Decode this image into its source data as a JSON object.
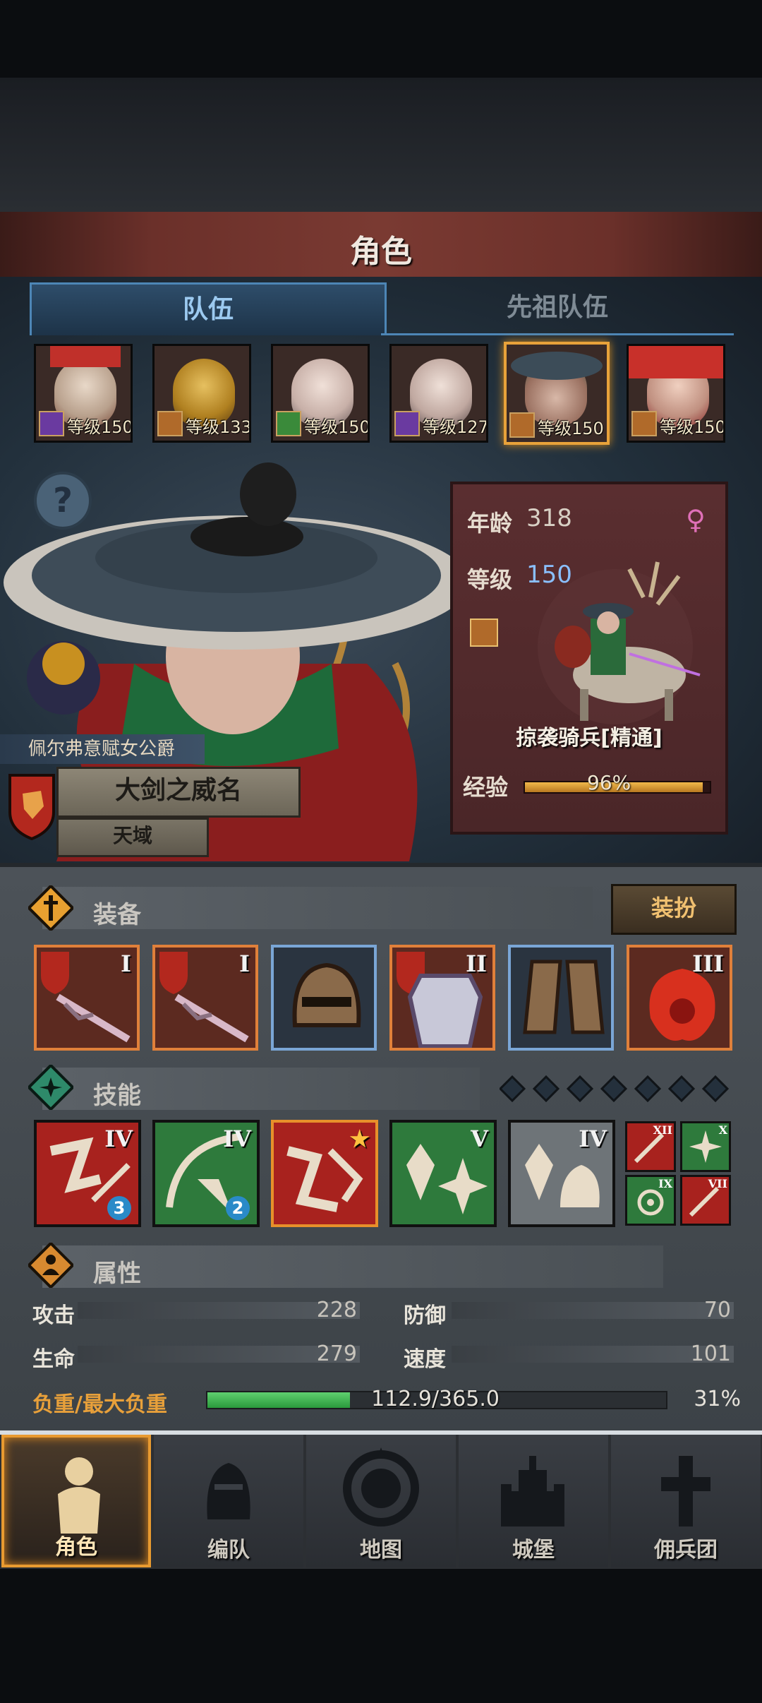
{
  "header": {
    "title": "角色"
  },
  "tabs": [
    {
      "label": "队伍",
      "active": true
    },
    {
      "label": "先祖队伍",
      "active": false
    }
  ],
  "team": [
    {
      "level_text": "等级150",
      "class_icon": "staff-icon",
      "selected": false
    },
    {
      "level_text": "等级133",
      "class_icon": "horse-icon",
      "selected": false
    },
    {
      "level_text": "等级150",
      "class_icon": "bow-icon",
      "selected": false
    },
    {
      "level_text": "等级127",
      "class_icon": "staff-icon",
      "selected": false
    },
    {
      "level_text": "等级150",
      "class_icon": "horse-icon",
      "selected": true
    },
    {
      "level_text": "等级150",
      "class_icon": "horse-icon",
      "selected": false
    }
  ],
  "hero": {
    "owner": "佩尔弗意赋女公爵",
    "name": "大剑之威名",
    "rank": "天域"
  },
  "stats_card": {
    "age_label": "年龄",
    "age": "318",
    "level_label": "等级",
    "level": "150",
    "class_name": "掠袭骑兵[精通]",
    "exp_label": "经验",
    "exp_text": "96%",
    "exp_fraction": 0.96
  },
  "equipment": {
    "title": "装备",
    "outfit_button": "装扮",
    "slots": [
      {
        "item": "rose-blade-icon",
        "tier": "I",
        "frame": "orange"
      },
      {
        "item": "rose-blade-icon",
        "tier": "I",
        "frame": "orange"
      },
      {
        "item": "helmet-icon",
        "tier": "",
        "frame": "blue"
      },
      {
        "item": "armor-icon",
        "tier": "II",
        "frame": "orange"
      },
      {
        "item": "boots-icon",
        "tier": "",
        "frame": "blue"
      },
      {
        "item": "phoenix-emblem-icon",
        "tier": "III",
        "frame": "orange"
      }
    ]
  },
  "skills": {
    "title": "技能",
    "main": [
      {
        "tier": "IV",
        "badge": "3",
        "color": "red"
      },
      {
        "tier": "IV",
        "badge": "2",
        "color": "green"
      },
      {
        "tier": "★",
        "badge": "",
        "color": "orange"
      },
      {
        "tier": "V",
        "badge": "",
        "color": "green"
      },
      {
        "tier": "IV",
        "badge": "",
        "color": "grey"
      }
    ],
    "mini": [
      {
        "tier": "XII",
        "color": "red"
      },
      {
        "tier": "X",
        "color": "green"
      },
      {
        "tier": "IX",
        "color": "green"
      },
      {
        "tier": "VII",
        "color": "red"
      }
    ]
  },
  "attributes": {
    "title": "属性",
    "attack_label": "攻击",
    "attack": "228",
    "defense_label": "防御",
    "defense": "70",
    "health_label": "生命",
    "health": "279",
    "speed_label": "速度",
    "speed": "101",
    "load_label": "负重/最大负重",
    "load_value": "112.9/365.0",
    "load_percent": "31%",
    "load_fraction": 0.31
  },
  "nav": [
    {
      "label": "角色",
      "icon": "knight-icon",
      "active": true
    },
    {
      "label": "编队",
      "icon": "helmet-formation-icon",
      "active": false
    },
    {
      "label": "地图",
      "icon": "compass-map-icon",
      "active": false
    },
    {
      "label": "城堡",
      "icon": "castle-icon",
      "active": false
    },
    {
      "label": "佣兵团",
      "icon": "mercenary-icon",
      "active": false
    }
  ],
  "colors": {
    "accent": "#e8a23a",
    "tab_active": "#9ccaf0",
    "exp_bar": "#f0b84a",
    "load_bar": "#5fd06f"
  }
}
